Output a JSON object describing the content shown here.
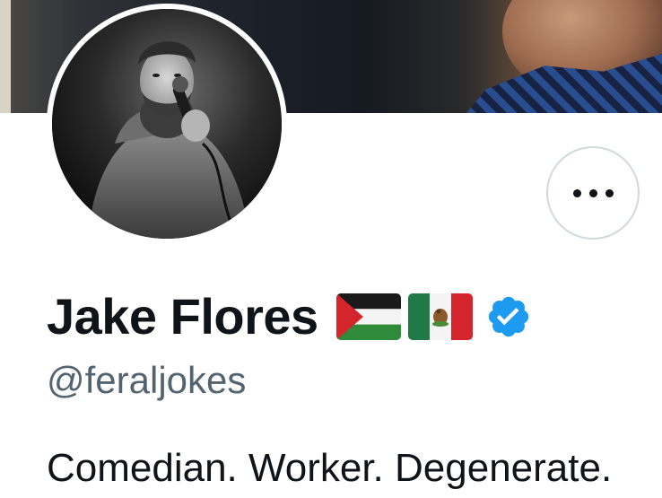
{
  "profile": {
    "display_name": "Jake Flores",
    "handle": "@feraljokes",
    "bio": "Comedian. Worker. Degenerate.",
    "name_badges": [
      "palestine-flag-icon",
      "mexico-flag-icon",
      "verified-badge-icon"
    ]
  },
  "actions": {
    "more_icon": "more-horizontal-icon"
  },
  "colors": {
    "text_primary": "#0f1419",
    "text_secondary": "#536471",
    "verified_blue": "#1d9bf0",
    "button_border": "#cfd9de"
  }
}
